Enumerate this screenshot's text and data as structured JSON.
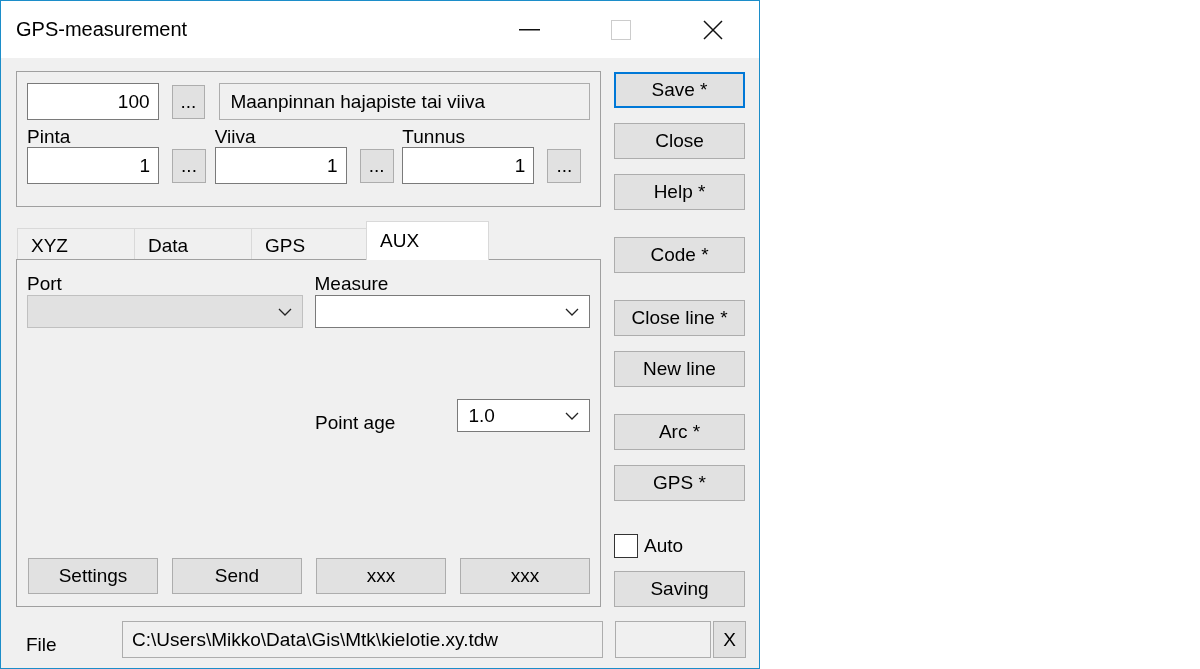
{
  "window": {
    "title": "GPS-measurement",
    "maximize_disabled": true
  },
  "header": {
    "code": "100",
    "code_button": "...",
    "description": "Maanpinnan hajapiste tai viiva",
    "fields": [
      {
        "label": "Pinta",
        "value": "1",
        "button": "..."
      },
      {
        "label": "Viiva",
        "value": "1",
        "button": "..."
      },
      {
        "label": "Tunnus",
        "value": "1",
        "button": "..."
      }
    ]
  },
  "tabs": [
    {
      "label": "XYZ",
      "selected": false
    },
    {
      "label": "Data",
      "selected": false
    },
    {
      "label": "GPS",
      "selected": false
    },
    {
      "label": "AUX",
      "selected": true
    }
  ],
  "aux": {
    "port": {
      "label": "Port",
      "disabled": true
    },
    "measure": {
      "label": "Measure",
      "disabled": false
    },
    "point_age": {
      "label": "Point age",
      "value": "1.0",
      "disabled": false
    },
    "buttons": [
      "Settings",
      "Send",
      "xxx",
      "xxx"
    ]
  },
  "side_buttons": [
    [
      {
        "label": "Save *",
        "default": true
      },
      {
        "label": "Close",
        "default": false
      },
      {
        "label": "Help *",
        "default": false
      }
    ],
    [
      {
        "label": "Code *",
        "default": false
      }
    ],
    [
      {
        "label": "Close line *",
        "default": false
      },
      {
        "label": "New line",
        "default": false
      }
    ],
    [
      {
        "label": "Arc *",
        "default": false
      },
      {
        "label": "GPS *",
        "default": false
      }
    ]
  ],
  "auto": {
    "label": "Auto",
    "checked": false
  },
  "saving_button": "Saving",
  "file": {
    "label": "File",
    "value": "C:\\Users\\Mikko\\Data\\Gis\\Mtk\\kielotie.xy.tdw"
  },
  "clear_button": "X"
}
